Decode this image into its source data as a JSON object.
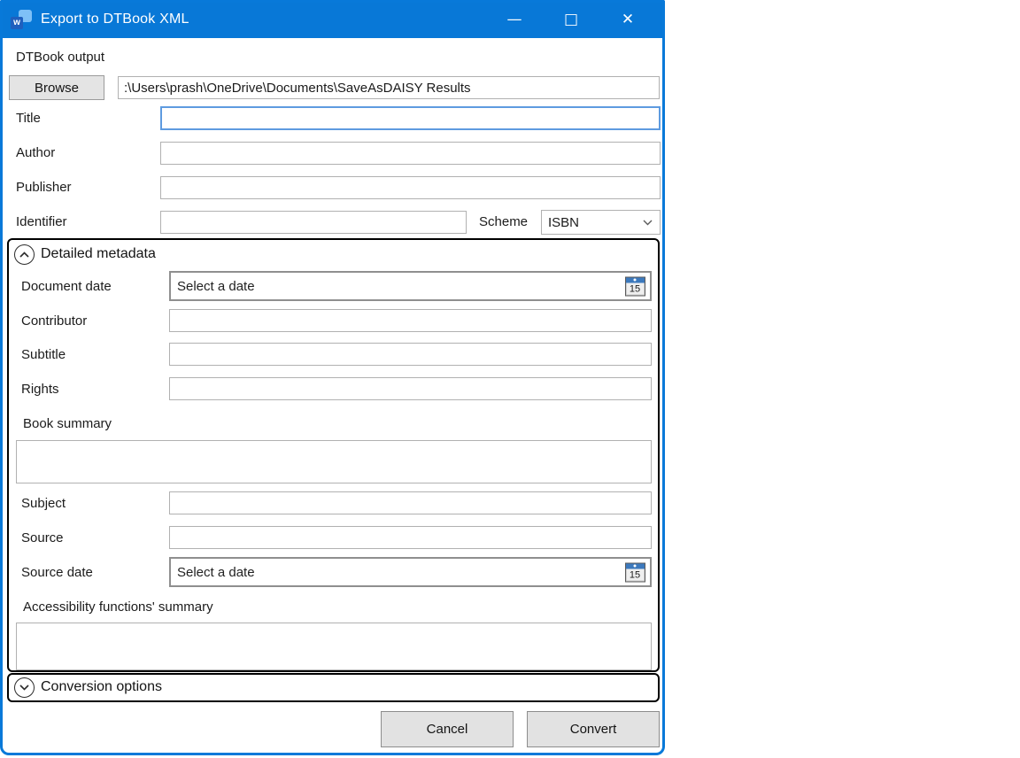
{
  "window": {
    "title": "Export to DTBook XML",
    "app_icon_letter": "w",
    "controls": {
      "minimize_glyph": "—",
      "maximize_glyph": "□",
      "close_glyph": "✕"
    }
  },
  "colors": {
    "titlebar": "#0878d7",
    "frame": "#0879d9",
    "focus_border": "#5e9be0",
    "calendar_header": "#3c79bd",
    "expander_border": "#000000",
    "button_face": "#e2e2e2"
  },
  "output_section": {
    "label": "DTBook output",
    "browse_button": "Browse",
    "path_value": ":\\Users\\prash\\OneDrive\\Documents\\SaveAsDAISY Results"
  },
  "basic_fields": {
    "title": {
      "label": "Title",
      "value": ""
    },
    "author": {
      "label": "Author",
      "value": ""
    },
    "publisher": {
      "label": "Publisher",
      "value": ""
    },
    "identifier": {
      "label": "Identifier",
      "value": ""
    },
    "scheme": {
      "label": "Scheme",
      "selected": "ISBN"
    }
  },
  "detailed_metadata": {
    "header_label": "Detailed metadata",
    "state": "expanded",
    "document_date": {
      "label": "Document date",
      "placeholder": "Select a date",
      "calendar_day": "15"
    },
    "contributor": {
      "label": "Contributor",
      "value": ""
    },
    "subtitle": {
      "label": "Subtitle",
      "value": ""
    },
    "rights": {
      "label": "Rights",
      "value": ""
    },
    "book_summary": {
      "label": "Book summary",
      "value": ""
    },
    "subject": {
      "label": "Subject",
      "value": ""
    },
    "source": {
      "label": "Source",
      "value": ""
    },
    "source_date": {
      "label": "Source date",
      "placeholder": "Select a date",
      "calendar_day": "15"
    },
    "accessibility_summary": {
      "label": "Accessibility functions' summary",
      "value": ""
    }
  },
  "conversion_options": {
    "header_label": "Conversion options",
    "state": "collapsed"
  },
  "actions": {
    "cancel": "Cancel",
    "convert": "Convert"
  }
}
